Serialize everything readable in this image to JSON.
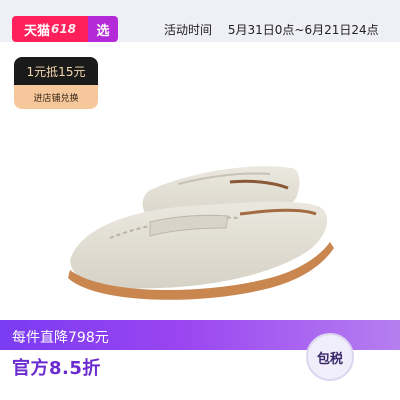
{
  "banner": {
    "brand_tmall": "天猫",
    "brand_number": "618",
    "brand_select": "选",
    "activity_label": "活动时间",
    "activity_range": "5月31日0点~6月21日24点"
  },
  "coupon": {
    "value": "1元抵15元",
    "action": "进店铺兑换"
  },
  "product": {
    "image_alt": "loafer shoes",
    "color_upper": "#e3e0d6",
    "color_sole": "#c9874f"
  },
  "promo": {
    "price_text": "每件直降798元",
    "discount_text": "官方8.5折",
    "tax_badge": "包税"
  }
}
